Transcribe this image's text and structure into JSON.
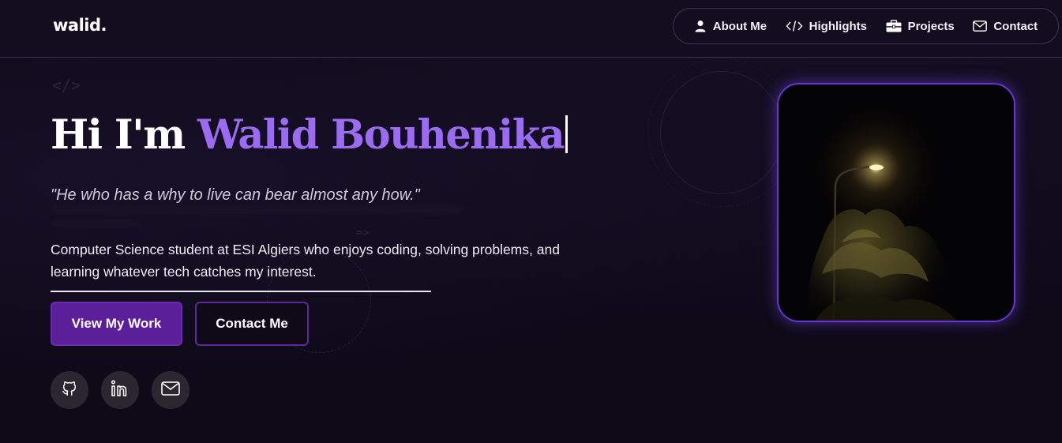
{
  "header": {
    "logo": "walid.",
    "nav": [
      {
        "label": "About Me",
        "icon": "user-icon"
      },
      {
        "label": "Highlights",
        "icon": "code-icon"
      },
      {
        "label": "Projects",
        "icon": "briefcase-icon"
      },
      {
        "label": "Contact",
        "icon": "mail-icon"
      }
    ]
  },
  "hero": {
    "code_tag": "</>",
    "arrow_tag": "=>",
    "greeting": "Hi I'm ",
    "name": "Walid Bouhenika",
    "quote": "\"He who has a why to live can bear almost any how.\"",
    "description": "Computer Science student at ESI Algiers who enjoys coding, solving problems, and learning whatever tech catches my interest.",
    "primary_button": "View My Work",
    "secondary_button": "Contact Me",
    "socials": [
      {
        "icon": "github-icon"
      },
      {
        "icon": "linkedin-icon"
      },
      {
        "icon": "mail-icon"
      }
    ]
  },
  "colors": {
    "background": "#0e0a18",
    "accent": "#9b6cf2",
    "primary_button": "#5a1f99",
    "photo_border": "#6a35d8"
  }
}
